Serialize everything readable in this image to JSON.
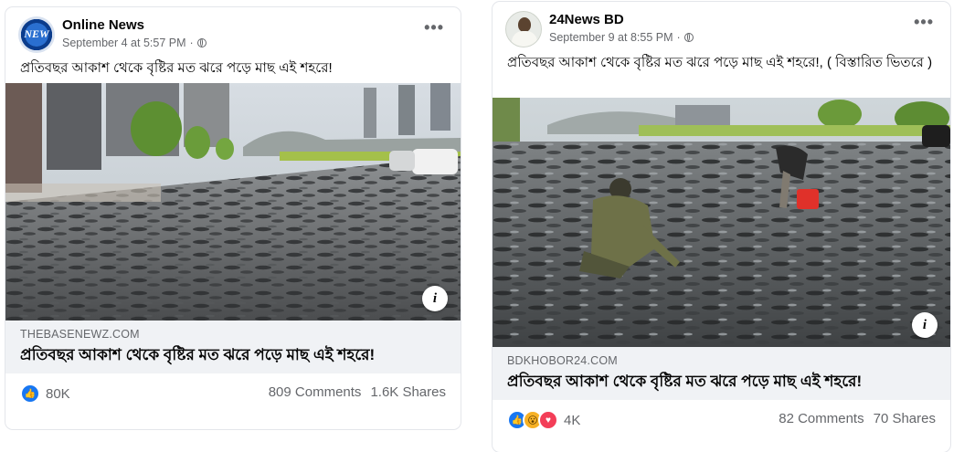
{
  "posts": [
    {
      "page_name": "Online News",
      "avatar_text": "NEW",
      "timestamp": "September 4 at 5:57 PM",
      "separator": "·",
      "caption": "প্রতিবছর আকাশ থেকে বৃষ্টির মত ঝরে পড়ে মাছ এই শহরে!",
      "link": {
        "domain": "THEBASENEWZ.COM",
        "title": "প্রতিবছর আকাশ থেকে বৃষ্টির মত ঝরে পড়ে মাছ এই শহরে!"
      },
      "reaction_count": "80K",
      "comments": "809 Comments",
      "shares": "1.6K Shares"
    },
    {
      "page_name": "24News BD",
      "timestamp": "September 9 at 8:55 PM",
      "separator": "·",
      "caption": "প্রতিবছর আকাশ থেকে বৃষ্টির মত ঝরে পড়ে মাছ এই শহরে!, ( বিস্তারিত ভিতরে )",
      "link": {
        "domain": "BDKHOBOR24.COM",
        "title": "প্রতিবছর আকাশ থেকে বৃষ্টির মত ঝরে পড়ে মাছ এই শহরে!"
      },
      "reaction_count": "4K",
      "comments": "82 Comments",
      "shares": "70 Shares"
    }
  ],
  "icons": {
    "more": "more-options-icon",
    "globe": "globe-icon",
    "info": "info-icon",
    "reactions": [
      "like-icon",
      "wow-icon",
      "love-icon"
    ]
  },
  "colors": {
    "like": "#1877f2",
    "wow": "#f7b125",
    "love": "#f33e58",
    "link_box": "#f0f2f5",
    "meta_text": "#65676b"
  }
}
